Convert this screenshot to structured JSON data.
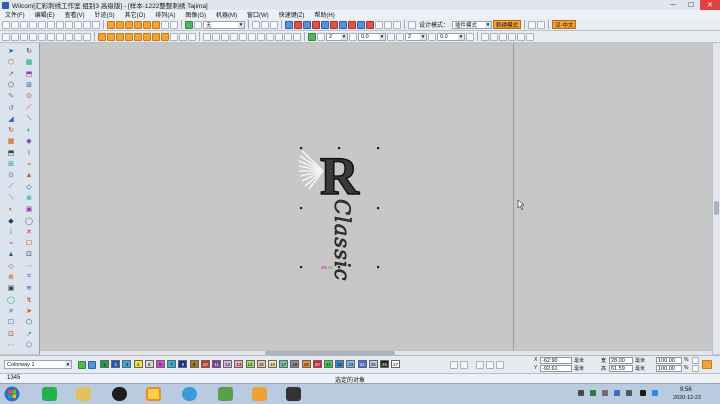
{
  "window": {
    "title": "Wilcom[汇彩刺绣工作室  组别3 高级版] - [样本-1222整整刺绣        Tajima]",
    "buttons": {
      "minimize": "─",
      "maximize": "☐",
      "close": "✕"
    }
  },
  "menu": [
    "文件(F)",
    "编辑(E)",
    "查看(V)",
    "针迹(S)",
    "其它(O)",
    "排列(A)",
    "图像(G)",
    "机器(M)",
    "窗口(W)",
    "快速键(Z)",
    "帮助(H)"
  ],
  "toolbar": {
    "fabric_value": "无",
    "design_mode_label": "设计模式：",
    "design_mode_value": "插件模式",
    "cn_mode_button": "刺绣模式",
    "lang_button": "汉·中文",
    "spin1": "2",
    "spin2": "0.0",
    "spin3": "2",
    "spin4": "0.0"
  },
  "design": {
    "letter": "R",
    "script_text": "Classic"
  },
  "colorway": {
    "label": "Colorway 1",
    "swatches": [
      {
        "n": "1",
        "c": "#1fa34a"
      },
      {
        "n": "2",
        "c": "#1f56c6"
      },
      {
        "n": "3",
        "c": "#3aa8e0"
      },
      {
        "n": "4",
        "c": "#f2e339"
      },
      {
        "n": "5",
        "c": "#d7d7d7"
      },
      {
        "n": "6",
        "c": "#d349d3"
      },
      {
        "n": "7",
        "c": "#2bb3c9"
      },
      {
        "n": "8",
        "c": "#1b2f8c"
      },
      {
        "n": "9",
        "c": "#a07a20"
      },
      {
        "n": "10",
        "c": "#c13a2c"
      },
      {
        "n": "11",
        "c": "#7e3aa1"
      },
      {
        "n": "12",
        "c": "#d9b3e6"
      },
      {
        "n": "13",
        "c": "#f6a3b8"
      },
      {
        "n": "14",
        "c": "#a6d86a"
      },
      {
        "n": "15",
        "c": "#f2c2a0"
      },
      {
        "n": "16",
        "c": "#efe4a8"
      },
      {
        "n": "17",
        "c": "#6fc2a7"
      },
      {
        "n": "18",
        "c": "#8c8c8c"
      },
      {
        "n": "19",
        "c": "#f08a2a"
      },
      {
        "n": "20",
        "c": "#e01e3a"
      },
      {
        "n": "21",
        "c": "#3fd14a"
      },
      {
        "n": "22",
        "c": "#2c90d6"
      },
      {
        "n": "23",
        "c": "#7cc0f0"
      },
      {
        "n": "24",
        "c": "#4a6ad1"
      },
      {
        "n": "25",
        "c": "#b3c9f0"
      },
      {
        "n": "26",
        "c": "#222222"
      },
      {
        "n": "27",
        "c": "#ffffff"
      }
    ]
  },
  "coords": {
    "x_label": "X",
    "y_label": "Y",
    "x": "-62.90",
    "y": "-92.61",
    "x_unit": "毫米",
    "y_unit": "毫米",
    "w_label": "宽",
    "h_label": "高",
    "w": "28.00",
    "h": "61.59",
    "w_unit": "毫米",
    "h_unit": "毫米",
    "sx": "100.00",
    "sy": "100.00",
    "sx_unit": "%",
    "sy_unit": "%"
  },
  "status": {
    "stitch_count": "1345",
    "message": "选定的对象"
  },
  "clock": {
    "time": "9:56",
    "date": "2020-12-22"
  }
}
